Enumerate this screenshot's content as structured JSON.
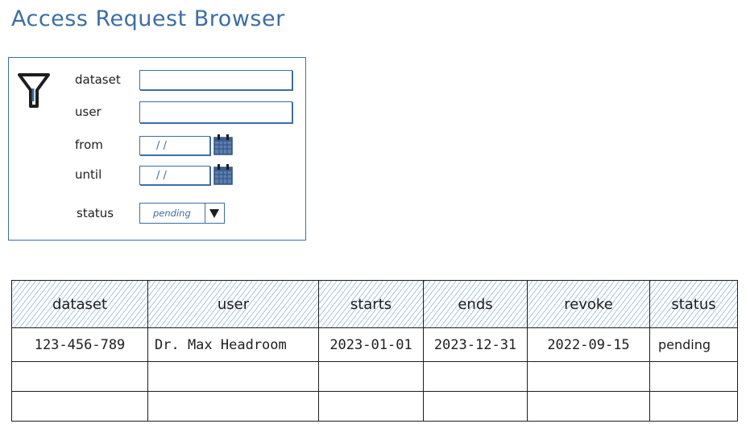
{
  "title": "Access Request Browser",
  "filter": {
    "icon": "funnel-icon",
    "dataset_label": "dataset",
    "dataset_value": "",
    "user_label": "user",
    "user_value": "",
    "from_label": "from",
    "from_value": "/ /",
    "until_label": "until",
    "until_value": "/ /",
    "calendar_icon": "calendar-icon",
    "status_label": "status",
    "status_value": "pending"
  },
  "table": {
    "columns": [
      "dataset",
      "user",
      "starts",
      "ends",
      "revoke",
      "status"
    ],
    "rows": [
      {
        "dataset": "123-456-789",
        "user": "Dr. Max Headroom",
        "starts": "2023-01-01",
        "ends": "2023-12-31",
        "revoke": "2022-09-15",
        "status": "pending"
      }
    ],
    "empty_rows": 2
  },
  "colors": {
    "accent": "#3b6ea8",
    "header_hatch": "#a7c5e6",
    "ink": "#1e1e1e"
  }
}
